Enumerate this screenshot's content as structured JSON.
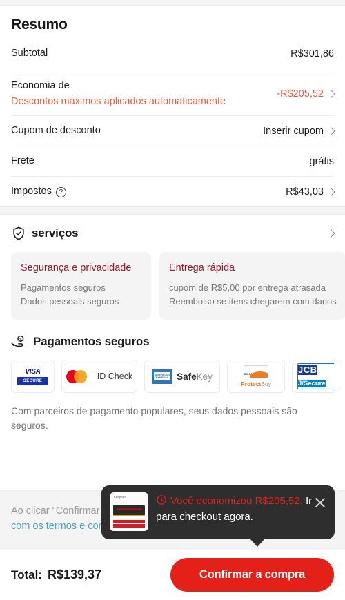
{
  "summary": {
    "title": "Resumo",
    "rows": [
      {
        "label": "Subtotal",
        "value": "R$301,86"
      },
      {
        "label": "Economia de",
        "sublabel": "Descontos máximos aplicados automaticamente",
        "value": "-R$205,52"
      },
      {
        "label": "Cupom de desconto",
        "value": "Inserir cupom"
      },
      {
        "label": "Frete",
        "value": "grátis"
      },
      {
        "label": "Impostos",
        "value": "R$43,03",
        "info_icon": "?"
      }
    ]
  },
  "services": {
    "title": "serviços",
    "icon": "shield-check-icon",
    "cards": [
      {
        "title": "Segurança e privacidade",
        "lines": [
          "Pagamentos seguros",
          "Dados pessoais seguros"
        ]
      },
      {
        "title": "Entrega rápida",
        "lines": [
          "cupom de R$5,00 por entrega atrasada",
          "Reembolso se itens chegarem com danos"
        ]
      }
    ]
  },
  "payments": {
    "title": "Pagamentos seguros",
    "icon": "hand-coin-icon",
    "logos": [
      {
        "name": "visa-secure-logo",
        "word": "VISA",
        "sub": "SECURE"
      },
      {
        "name": "mastercard-id-check-logo",
        "text": "ID Check"
      },
      {
        "name": "amex-safekey-logo",
        "card": "AMERICAN EXPRESS",
        "bold": "Safe",
        "light": "Key"
      },
      {
        "name": "discover-protectbuy-logo",
        "card": "DISCOVER",
        "bold": "Protect",
        "light": "Buy"
      },
      {
        "name": "jcb-jsecure-logo",
        "top": "JCB",
        "bottom": "J/Secure"
      }
    ],
    "note": "Com parceiros de pagamento populares, seus dados pessoais são seguros."
  },
  "terms": {
    "line1": "Ao clicar \"Confirmar a compra\", você concorda",
    "line2_prefix": "com os termos e condições de uso",
    "line2_suffix": ""
  },
  "bottom": {
    "total_label": "Total:",
    "total_value": "R$139,37",
    "confirm_label": "Confirmar a compra"
  },
  "toast": {
    "icon": "clock-icon",
    "highlight": "Você economizou R$205,52.",
    "rest": " Ir para checkout agora.",
    "close_icon": "close-icon",
    "thumb_name": "ram-module-thumbnail"
  },
  "colors": {
    "accent_red": "#e32119",
    "discount_orange": "#e0604a",
    "card_title_maroon": "#8f1d2e",
    "link_blue": "#4da3c7"
  }
}
